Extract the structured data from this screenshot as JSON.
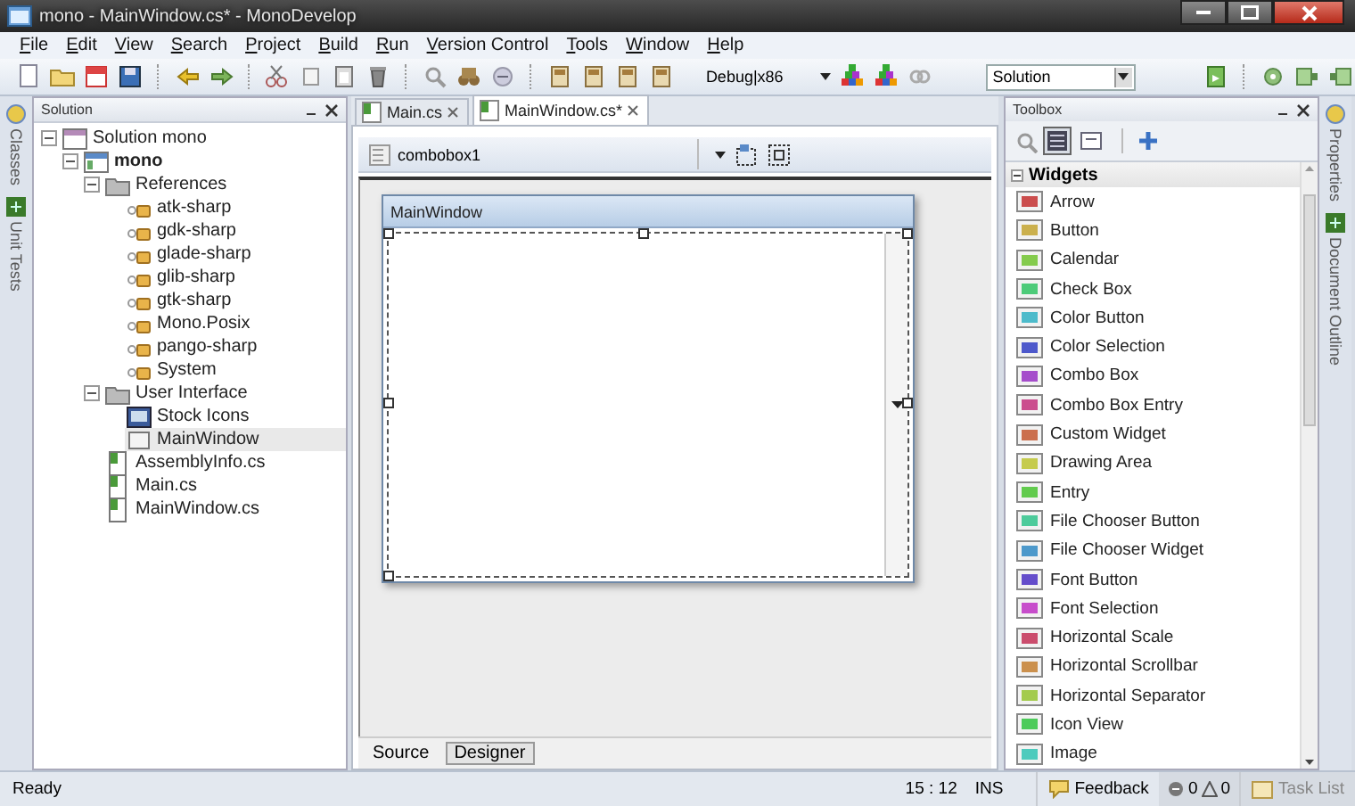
{
  "window": {
    "title": "mono - MainWindow.cs* - MonoDevelop"
  },
  "menu": [
    "File",
    "Edit",
    "View",
    "Search",
    "Project",
    "Build",
    "Run",
    "Version Control",
    "Tools",
    "Window",
    "Help"
  ],
  "toolbar": {
    "configuration": "Debug|x86",
    "scope": "Solution"
  },
  "side_tabs_left": [
    "Classes",
    "Unit Tests"
  ],
  "solution_pane": {
    "title": "Solution",
    "tree": [
      {
        "label": "Solution mono",
        "kind": "solution",
        "expanded": true,
        "selected": false,
        "children": [
          {
            "label": "mono",
            "kind": "project",
            "expanded": true,
            "selected": false,
            "children": [
              {
                "label": "References",
                "kind": "folder",
                "expanded": true,
                "selected": false,
                "children": [
                  {
                    "label": "atk-sharp",
                    "kind": "reference",
                    "selected": false
                  },
                  {
                    "label": "gdk-sharp",
                    "kind": "reference",
                    "selected": false
                  },
                  {
                    "label": "glade-sharp",
                    "kind": "reference",
                    "selected": false
                  },
                  {
                    "label": "glib-sharp",
                    "kind": "reference",
                    "selected": false
                  },
                  {
                    "label": "gtk-sharp",
                    "kind": "reference",
                    "selected": false
                  },
                  {
                    "label": "Mono.Posix",
                    "kind": "reference",
                    "selected": false
                  },
                  {
                    "label": "pango-sharp",
                    "kind": "reference",
                    "selected": false
                  },
                  {
                    "label": "System",
                    "kind": "reference",
                    "selected": false
                  }
                ]
              },
              {
                "label": "User Interface",
                "kind": "folder",
                "expanded": true,
                "selected": false,
                "children": [
                  {
                    "label": "Stock Icons",
                    "kind": "icons",
                    "selected": false
                  },
                  {
                    "label": "MainWindow",
                    "kind": "window",
                    "selected": true
                  }
                ]
              },
              {
                "label": "AssemblyInfo.cs",
                "kind": "file",
                "selected": false
              },
              {
                "label": "Main.cs",
                "kind": "file",
                "selected": false
              },
              {
                "label": "MainWindow.cs",
                "kind": "file",
                "selected": false
              }
            ]
          }
        ]
      }
    ]
  },
  "editor": {
    "tabs": [
      {
        "label": "Main.cs",
        "selected": false
      },
      {
        "label": "MainWindow.cs*",
        "selected": true
      }
    ],
    "widget_combo": "combobox1",
    "design_window_title": "MainWindow",
    "bottom_tabs": [
      {
        "label": "Source",
        "selected": false
      },
      {
        "label": "Designer",
        "selected": true
      }
    ]
  },
  "toolbox": {
    "title": "Toolbox",
    "list_view": true,
    "category": "Widgets",
    "expanded": true,
    "items": [
      "Arrow",
      "Button",
      "Calendar",
      "Check Box",
      "Color Button",
      "Color Selection",
      "Combo Box",
      "Combo Box Entry",
      "Custom Widget",
      "Drawing Area",
      "Entry",
      "File Chooser Button",
      "File Chooser Widget",
      "Font Button",
      "Font Selection",
      "Horizontal Scale",
      "Horizontal Scrollbar",
      "Horizontal Separator",
      "Icon View",
      "Image"
    ]
  },
  "side_tabs_right": [
    "Properties",
    "Document Outline"
  ],
  "status_bar": {
    "message": "Ready",
    "position": "15 : 12",
    "mode": "INS",
    "feedback": "Feedback",
    "errors": "0",
    "warnings": "0",
    "task_list": "Task List"
  }
}
